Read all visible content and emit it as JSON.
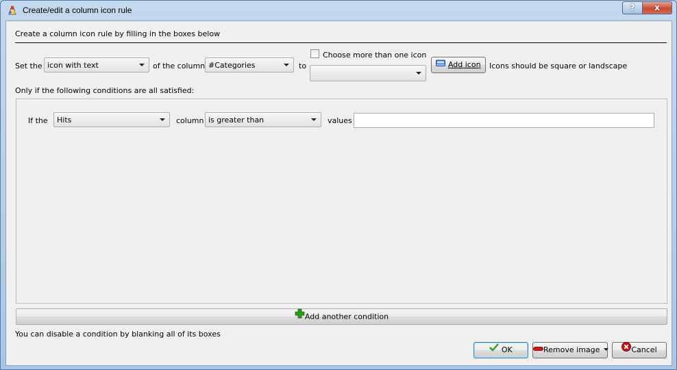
{
  "window": {
    "title": "Create/edit a column icon rule",
    "help_glyph": "?",
    "close_glyph": "x"
  },
  "intro": "Create a column icon rule by filling in the boxes below",
  "rule": {
    "set_the_label": "Set the",
    "kind_value": "icon with text",
    "of_column_label": "of the column:",
    "column_value": "#Categories",
    "to_label": "to",
    "choose_more_label": "Choose more than one icon",
    "choose_more_checked": false,
    "icon_value": "",
    "add_icon_label": "Add icon",
    "icons_hint": "Icons should be square or landscape"
  },
  "conditions_heading": "Only if the following conditions are all satisfied:",
  "condition": {
    "if_the_label": "If the",
    "column_value": "Hits",
    "column_label": "column",
    "operator_value": "is greater than",
    "values_label": "values",
    "values_value": ""
  },
  "add_condition_label": "Add another condition",
  "disable_hint": "You can disable a condition by blanking all of its boxes",
  "buttons": {
    "ok": "OK",
    "remove_image": "Remove image",
    "cancel": "Cancel"
  },
  "colors": {
    "add_green": "#2e9b1f",
    "ok_check": "#3aa12c",
    "remove_red": "#d0191b",
    "cancel_red": "#c41616"
  }
}
